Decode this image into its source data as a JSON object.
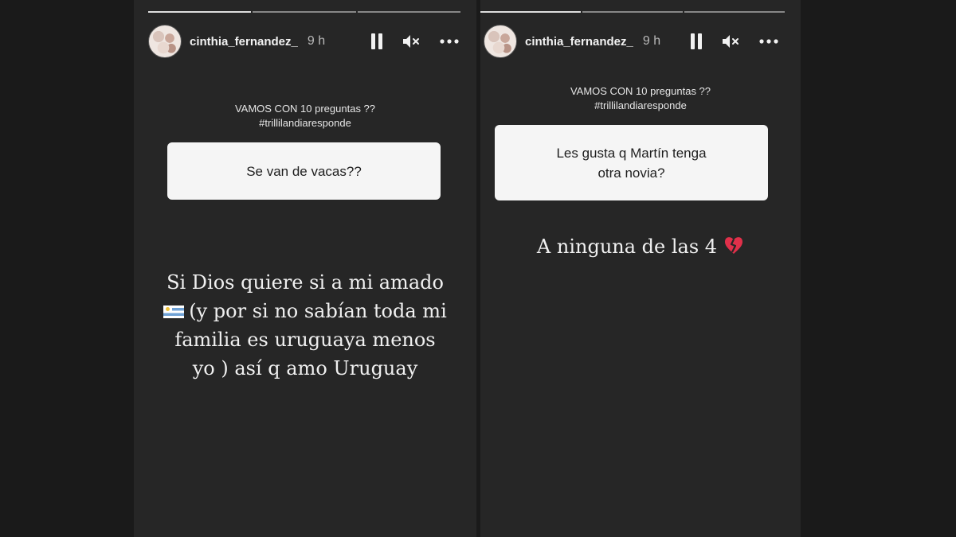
{
  "stories": [
    {
      "username": "cinthia_fernandez_",
      "time": "9 h",
      "question_title": "VAMOS CON 10 preguntas ??",
      "hashtag": "#trillilandiaresponde",
      "question": "Se van de vacas??",
      "answer_lines": [
        "Si Dios quiere si a mi amado",
        "(y por si no sabían toda mi",
        "familia es uruguaya menos",
        "yo ) así q amo Uruguay"
      ]
    },
    {
      "username": "cinthia_fernandez_",
      "time": "9 h",
      "question_title": "VAMOS CON 10 preguntas ??",
      "hashtag": "#trillilandiaresponde",
      "question_lines": [
        "Les gusta q Martín tenga",
        "otra novia?"
      ],
      "answer": "A ninguna de las 4"
    }
  ],
  "icons": {
    "pause": "pause-icon",
    "mute": "speaker-muted-icon",
    "more": "more-options-icon",
    "flag": "uruguay-flag-icon",
    "heart": "broken-heart-icon"
  },
  "colors": {
    "background": "#1a1a1a",
    "story_bg": "#262626",
    "card": "#f5f5f5",
    "heart": "#e0304a"
  }
}
